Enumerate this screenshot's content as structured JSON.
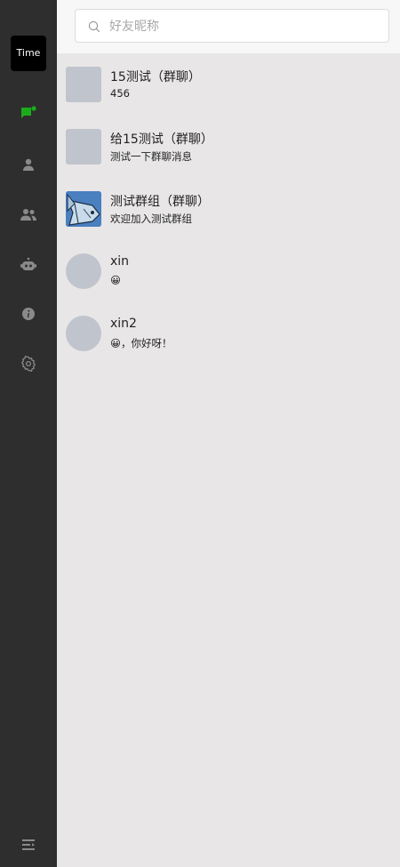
{
  "sidebar": {
    "logo_text": "Time",
    "active_color": "#1aad19",
    "icon_color": "#8a8a8a",
    "items": [
      {
        "name": "chat-icon",
        "active": true
      },
      {
        "name": "contact-icon",
        "active": false
      },
      {
        "name": "group-icon",
        "active": false
      },
      {
        "name": "robot-icon",
        "active": false
      },
      {
        "name": "info-icon",
        "active": false
      },
      {
        "name": "settings-icon",
        "active": false
      }
    ],
    "menu_icon": "menu-icon"
  },
  "search": {
    "placeholder": "好友昵称",
    "value": ""
  },
  "chats": [
    {
      "name": "15测试（群聊）",
      "message": "456",
      "avatar": "gray-square"
    },
    {
      "name": "给15测试（群聊）",
      "message": "测试一下群聊消息",
      "avatar": "gray-square"
    },
    {
      "name": "测试群组（群聊）",
      "message": "欢迎加入测试群组",
      "avatar": "fish-image"
    },
    {
      "name": "xin",
      "message": "😀",
      "avatar": "gray-circle"
    },
    {
      "name": "xin2",
      "message": "😀，你好呀！",
      "avatar": "gray-circle"
    }
  ]
}
